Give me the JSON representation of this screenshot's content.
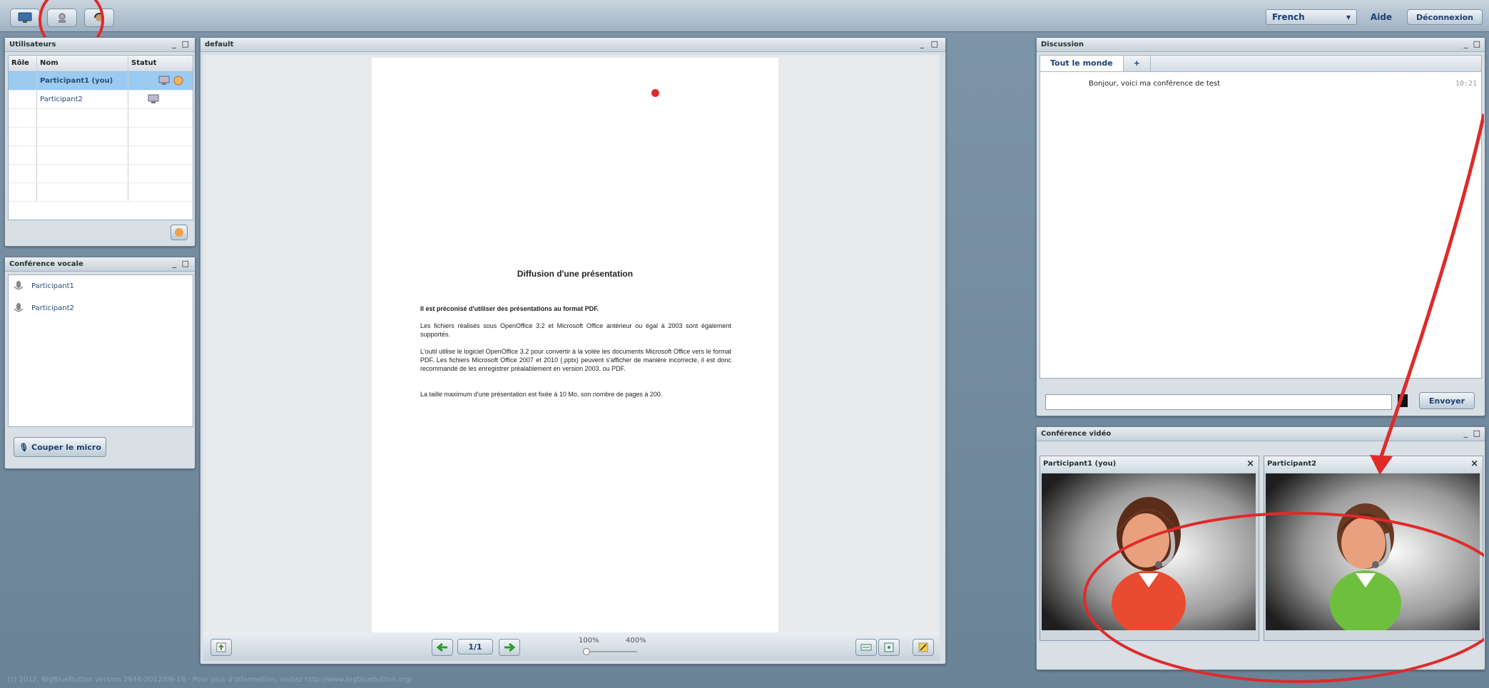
{
  "toolbar": {
    "buttons": [
      "presentation-icon",
      "webcam-icon",
      "headset-icon"
    ],
    "language": "French",
    "help_label": "Aide",
    "logout_label": "Déconnexion"
  },
  "users_panel": {
    "title": "Utilisateurs",
    "columns": [
      "Rôle",
      "Nom",
      "Statut"
    ],
    "rows": [
      {
        "name": "Participant1 (you)",
        "selected": true
      },
      {
        "name": "Participant2",
        "selected": false
      }
    ]
  },
  "voice_panel": {
    "title": "Conférence vocale",
    "participants": [
      "Participant1",
      "Participant2"
    ],
    "mute_label": "Couper le micro"
  },
  "presentation": {
    "title": "default",
    "page": {
      "heading": "Diffusion d'une présentation",
      "bold_line": "Il est préconisé d'utiliser des présentations au format PDF.",
      "para1": "Les fichiers réalisés sous OpenOffice 3.2 et Microsoft Office antérieur ou égal à 2003 sont également supportés.",
      "para2": "L'outil utilise le logiciel OpenOffice 3.2 pour convertir à la volée les documents Microsoft Office vers le format PDF. Les fichiers Microsoft Office 2007 et 2010 (.pptx) peuvent s'afficher de manière incorrecte, il est donc recommandé de les enregistrer préalablement en version 2003, ou PDF.",
      "para3": "La taille maximum d'une présentation est fixée à 10 Mo, son nombre de pages à 200."
    },
    "page_indicator": "1/1",
    "zoom_min": "100%",
    "zoom_max": "400%"
  },
  "chat_panel": {
    "title": "Discussion",
    "tabs": [
      "Tout le monde",
      "+"
    ],
    "messages": [
      {
        "text": "Bonjour, voici ma conférence de test",
        "time": "10:21"
      }
    ],
    "input_value": "",
    "send_label": "Envoyer"
  },
  "video_panel": {
    "title": "Conférence vidéo",
    "tiles": [
      {
        "name": "Participant1 (you)",
        "shirt_color": "#e84b2f"
      },
      {
        "name": "Participant2",
        "shirt_color": "#6fbf3f"
      }
    ],
    "close_symbol": "×"
  },
  "panel_controls": {
    "minimize": "_",
    "maximize": "□"
  },
  "footer": {
    "status": "(c) 2012, BigBlueButton version 2944-2012/09-18 - Pour plus d'information, visitez http://www.bigbluebutton.org/"
  },
  "annotation_color": "#e02a2a"
}
